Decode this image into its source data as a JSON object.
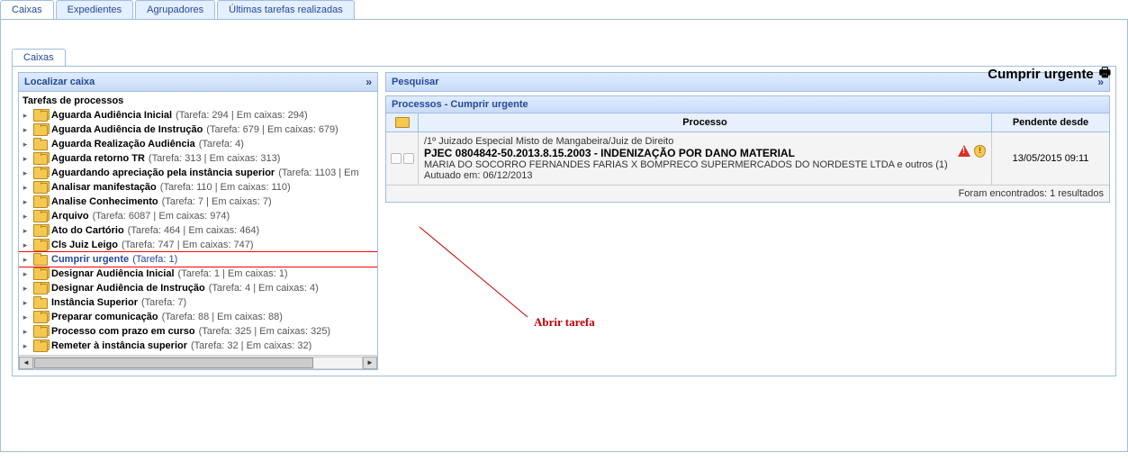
{
  "outer_tabs": [
    "Caixas",
    "Expedientes",
    "Agrupadores",
    "Últimas tarefas realizadas"
  ],
  "inner_tab": "Caixas",
  "page_title": "Cumprir urgente",
  "localizar_label": "Localizar caixa",
  "expand_symbol": "»",
  "tree_title": "Tarefas de processos",
  "tree_items": [
    {
      "label": "Aguarda Audiência Inicial",
      "counts": "(Tarefa: 294 | Em caixas: 294)",
      "multi": true
    },
    {
      "label": "Aguarda Audiência de Instrução",
      "counts": "(Tarefa: 679 | Em caixas: 679)",
      "multi": true
    },
    {
      "label": "Aguarda Realização Audiência",
      "counts": "(Tarefa: 4)",
      "multi": false
    },
    {
      "label": "Aguarda retorno TR",
      "counts": "(Tarefa: 313 | Em caixas: 313)",
      "multi": true
    },
    {
      "label": "Aguardando apreciação pela instância superior",
      "counts": "(Tarefa: 1103 | Em",
      "multi": true
    },
    {
      "label": "Analisar manifestação",
      "counts": "(Tarefa: 110 | Em caixas: 110)",
      "multi": true
    },
    {
      "label": "Analise Conhecimento",
      "counts": "(Tarefa: 7 | Em caixas: 7)",
      "multi": true
    },
    {
      "label": "Arquivo",
      "counts": "(Tarefa: 6087 | Em caixas: 974)",
      "multi": true
    },
    {
      "label": "Ato do Cartório",
      "counts": "(Tarefa: 464 | Em caixas: 464)",
      "multi": true
    },
    {
      "label": "Cls Juiz Leigo",
      "counts": "(Tarefa: 747 | Em caixas: 747)",
      "multi": true
    },
    {
      "label": "Cumprir urgente",
      "counts": "(Tarefa: 1)",
      "multi": false,
      "selected": true
    },
    {
      "label": "Designar Audiência Inicial",
      "counts": "(Tarefa: 1 | Em caixas: 1)",
      "multi": true
    },
    {
      "label": "Designar Audiência de Instrução",
      "counts": "(Tarefa: 4 | Em caixas: 4)",
      "multi": true
    },
    {
      "label": "Instância Superior",
      "counts": "(Tarefa: 7)",
      "multi": false
    },
    {
      "label": "Preparar comunicação",
      "counts": "(Tarefa: 88 | Em caixas: 88)",
      "multi": true
    },
    {
      "label": "Processo com prazo em curso",
      "counts": "(Tarefa: 325 | Em caixas: 325)",
      "multi": true
    },
    {
      "label": "Remeter à instância superior",
      "counts": "(Tarefa: 32 | Em caixas: 32)",
      "multi": true
    }
  ],
  "pesquisar_label": "Pesquisar",
  "grid_title": "Processos - Cumprir urgente",
  "col_processo": "Processo",
  "col_pendente": "Pendente desde",
  "row": {
    "line1": "/1º Juizado Especial Misto de Mangabeira/Juiz de Direito",
    "line2": "PJEC 0804842-50.2013.8.15.2003 - INDENIZAÇÃO POR DANO MATERIAL",
    "line3": "MARIA DO SOCORRO FERNANDES FARIAS X BOMPRECO SUPERMERCADOS DO NORDESTE LTDA e outros (1)",
    "line4": "Autuado em: 06/12/2013",
    "pendente": "13/05/2015 09:11"
  },
  "grid_foot": "Foram encontrados: 1 resultados",
  "annotation": "Abrir tarefa"
}
